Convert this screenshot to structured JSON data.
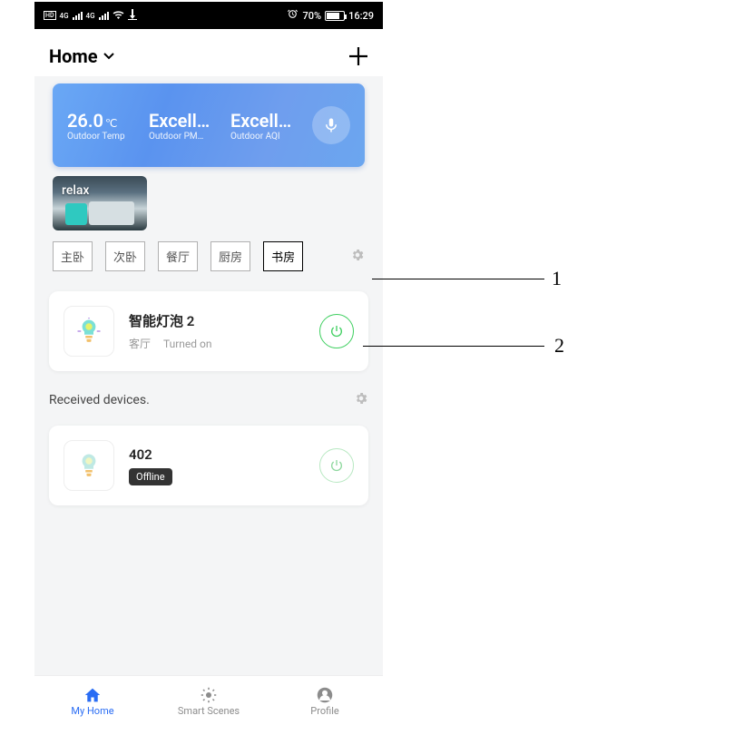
{
  "statusbar": {
    "hd_badge": "HD",
    "net1_badge": "4G",
    "net2_badge": "4G",
    "battery_pct_text": "70%",
    "battery_pct": 70,
    "time": "16:29",
    "alarm_glyph": "⏰",
    "wifi_glyph": "⧉",
    "download_glyph": "↓"
  },
  "header": {
    "title": "Home"
  },
  "weather": {
    "metrics": [
      {
        "value": "26.0",
        "unit": "℃",
        "label": "Outdoor Temp"
      },
      {
        "value": "Excell…",
        "unit": "",
        "label": "Outdoor PM…"
      },
      {
        "value": "Excell…",
        "unit": "",
        "label": "Outdoor AQI"
      }
    ]
  },
  "scenes": [
    {
      "label": "relax"
    }
  ],
  "rooms": [
    "主卧",
    "次卧",
    "餐厅",
    "厨房",
    "书房"
  ],
  "selected_room_index": 4,
  "devices": [
    {
      "name": "智能灯泡 2",
      "room": "客厅",
      "status": "Turned on",
      "offline": false
    }
  ],
  "received_section_title": "Received devices.",
  "received_devices": [
    {
      "name": "402",
      "offline": true,
      "offline_text": "Offline"
    }
  ],
  "bottom_nav": [
    {
      "label": "My Home",
      "active": true
    },
    {
      "label": "Smart Scenes",
      "active": false
    },
    {
      "label": "Profile",
      "active": false
    }
  ],
  "callouts": [
    {
      "id": "1",
      "label": "1"
    },
    {
      "id": "2",
      "label": "2"
    }
  ]
}
